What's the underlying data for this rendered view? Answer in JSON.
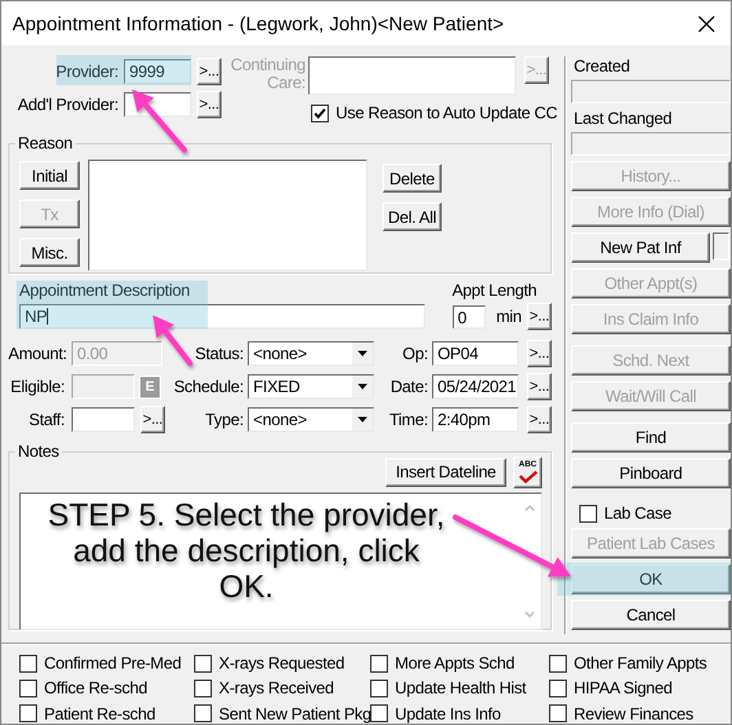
{
  "window": {
    "title": "Appointment Information - (Legwork, John)<New Patient>"
  },
  "provider": {
    "label": "Provider:",
    "value": "9999",
    "browse": ">...",
    "highlighted": true
  },
  "addl_provider": {
    "label": "Add'l Provider:",
    "browse": ">..."
  },
  "continuing_care": {
    "label": "Continuing Care:",
    "browse": ">...",
    "disabled": true
  },
  "use_reason": {
    "label": "Use Reason to Auto Update CC",
    "checked": true
  },
  "reason": {
    "title": "Reason",
    "buttons": [
      {
        "label": "Initial",
        "disabled": false
      },
      {
        "label": "Tx",
        "disabled": true
      },
      {
        "label": "Misc.",
        "disabled": false
      }
    ],
    "side_buttons": [
      {
        "label": "Delete",
        "disabled": false
      },
      {
        "label": "Del. All",
        "disabled": false
      }
    ]
  },
  "description": {
    "label": "Appointment Description",
    "value": "NP",
    "highlighted": true
  },
  "appt_length": {
    "label": "Appt Length",
    "value": "0",
    "unit": "min",
    "browse": ">..."
  },
  "amount": {
    "label": "Amount:",
    "value": "0.00",
    "disabled": true
  },
  "eligible": {
    "label": "Eligible:",
    "button": "E"
  },
  "staff": {
    "label": "Staff:",
    "browse": ">..."
  },
  "selects": [
    {
      "label": "Status:",
      "value": "<none>"
    },
    {
      "label": "Schedule:",
      "value": "FIXED"
    },
    {
      "label": "Type:",
      "value": "<none>"
    }
  ],
  "schedule_fields": [
    {
      "label": "Op:",
      "value": "OP04",
      "browse": ">..."
    },
    {
      "label": "Date:",
      "value": "05/24/2021",
      "browse": ">..."
    },
    {
      "label": "Time:",
      "value": "2:40pm",
      "browse": ">..."
    }
  ],
  "notes": {
    "title": "Notes",
    "insert_button": "Insert Dateline",
    "spell_label": "ABC",
    "callout": "STEP 5. Select the provider, add the description, click OK."
  },
  "side": [
    {
      "kind": "field",
      "label": "Created"
    },
    {
      "kind": "field",
      "label": "Last Changed"
    },
    {
      "kind": "button",
      "label": "History...",
      "disabled": true
    },
    {
      "kind": "button",
      "label": "More Info (Dial)",
      "disabled": true
    },
    {
      "kind": "button",
      "label": "New Pat Inf",
      "disabled": false,
      "has_box": true
    },
    {
      "kind": "button",
      "label": "Other Appt(s)",
      "disabled": true
    },
    {
      "kind": "button",
      "label": "Ins Claim Info",
      "disabled": true
    },
    {
      "kind": "button",
      "label": "Schd. Next",
      "disabled": true,
      "group_start": true
    },
    {
      "kind": "button",
      "label": "Wait/Will Call",
      "disabled": true
    },
    {
      "kind": "button",
      "label": "Find",
      "disabled": false,
      "group_start": true
    },
    {
      "kind": "button",
      "label": "Pinboard",
      "disabled": false
    },
    {
      "kind": "checkbox",
      "label": "Lab Case",
      "checked": false
    },
    {
      "kind": "button",
      "label": "Patient Lab Cases",
      "disabled": true
    },
    {
      "kind": "button",
      "label": "OK",
      "disabled": false,
      "highlighted": true
    },
    {
      "kind": "button",
      "label": "Cancel",
      "disabled": false
    }
  ],
  "flags": [
    {
      "label": "Confirmed Pre-Med",
      "checked": false
    },
    {
      "label": "X-rays Requested",
      "checked": false
    },
    {
      "label": "More Appts Schd",
      "checked": false
    },
    {
      "label": "Other Family Appts",
      "checked": false
    },
    {
      "label": "Office Re-schd",
      "checked": false
    },
    {
      "label": "X-rays Received",
      "checked": false
    },
    {
      "label": "Update Health Hist",
      "checked": false
    },
    {
      "label": "HIPAA Signed",
      "checked": false
    },
    {
      "label": "Patient Re-schd",
      "checked": false
    },
    {
      "label": "Sent New Patient Pkg",
      "checked": false
    },
    {
      "label": "Update Ins Info",
      "checked": false
    },
    {
      "label": "Review Finances",
      "checked": false
    }
  ]
}
